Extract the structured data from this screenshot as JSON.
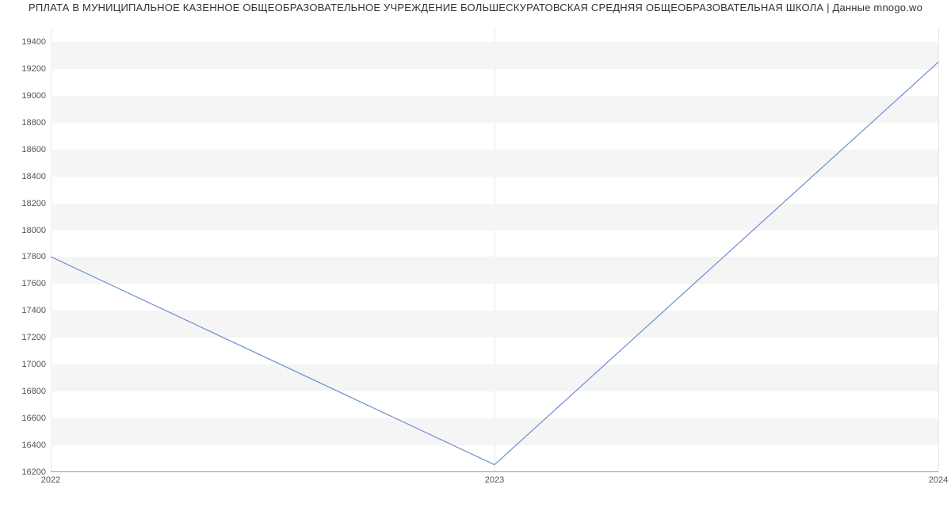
{
  "chart_data": {
    "type": "line",
    "title": "РПЛАТА В МУНИЦИПАЛЬНОЕ КАЗЕННОЕ ОБЩЕОБРАЗОВАТЕЛЬНОЕ УЧРЕЖДЕНИЕ БОЛЬШЕСКУРАТОВСКАЯ СРЕДНЯЯ ОБЩЕОБРАЗОВАТЕЛЬНАЯ ШКОЛА | Данные mnogo.wo",
    "x": [
      2022,
      2023,
      2024
    ],
    "values": [
      17800,
      16250,
      19250
    ],
    "xlabel": "",
    "ylabel": "",
    "xlim": [
      2022,
      2024
    ],
    "ylim": [
      16200,
      19500
    ],
    "y_ticks": [
      16200,
      16400,
      16600,
      16800,
      17000,
      17200,
      17400,
      17600,
      17800,
      18000,
      18200,
      18400,
      18600,
      18800,
      19000,
      19200,
      19400
    ],
    "x_ticks": [
      2022,
      2023,
      2024
    ],
    "grid": "y-alternating-bands",
    "band_color": "#f5f5f5",
    "line_color": "#6c8ecf"
  }
}
